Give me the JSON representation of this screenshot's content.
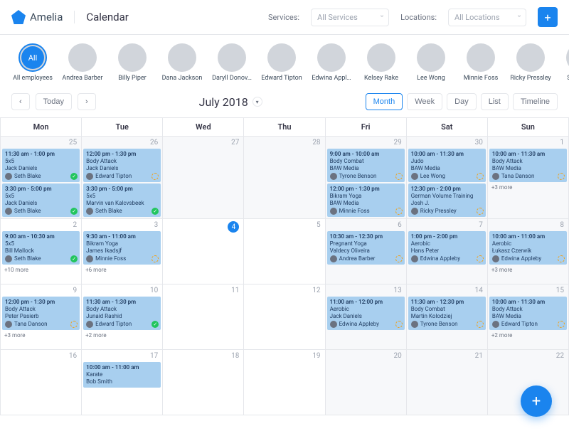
{
  "app": {
    "name": "Amelia",
    "page": "Calendar"
  },
  "filters": {
    "services_label": "Services:",
    "services_value": "All Services",
    "locations_label": "Locations:",
    "locations_value": "All Locations"
  },
  "employees": [
    {
      "name": "All employees",
      "all": true,
      "label": "All"
    },
    {
      "name": "Andrea Barber"
    },
    {
      "name": "Billy Piper"
    },
    {
      "name": "Dana Jackson"
    },
    {
      "name": "Daryll Donov…"
    },
    {
      "name": "Edward Tipton"
    },
    {
      "name": "Edwina Appl…"
    },
    {
      "name": "Kelsey Rake"
    },
    {
      "name": "Lee Wong"
    },
    {
      "name": "Minnie Foss"
    },
    {
      "name": "Ricky Pressley"
    },
    {
      "name": "Seth Blak"
    }
  ],
  "toolbar": {
    "today": "Today",
    "month_label": "July 2018",
    "views": [
      "Month",
      "Week",
      "Day",
      "List",
      "Timeline"
    ],
    "active_view": "Month"
  },
  "dow": [
    "Mon",
    "Tue",
    "Wed",
    "Thu",
    "Fri",
    "Sat",
    "Sun"
  ],
  "weeks": [
    [
      {
        "n": 25,
        "dim": true,
        "events": [
          {
            "time": "11:30 am - 1:00 pm",
            "title": "5x5",
            "sub": "Jack Daniels",
            "person": "Seth Blake",
            "status": "done"
          },
          {
            "time": "3:30 pm - 5:00 pm",
            "title": "5x5",
            "sub": "Jack Daniels",
            "person": "Seth Blake",
            "status": "done"
          }
        ]
      },
      {
        "n": 26,
        "dim": true,
        "events": [
          {
            "time": "12:00 pm - 1:30 pm",
            "title": "Body Attack",
            "sub": "Jack Daniels",
            "person": "Edward Tipton",
            "status": "pending"
          },
          {
            "time": "3:30 pm - 5:00 pm",
            "title": "5x5",
            "sub": "Marvin van Kalcvsbeek",
            "person": "Seth Blake",
            "status": "done"
          }
        ]
      },
      {
        "n": 27,
        "dim": true,
        "events": []
      },
      {
        "n": 28,
        "dim": true,
        "events": []
      },
      {
        "n": 29,
        "dim": true,
        "events": [
          {
            "time": "9:00 am - 10:00 am",
            "title": "Body Combat",
            "sub": "BAW Media",
            "person": "Tyrone Benson",
            "status": "pending"
          },
          {
            "time": "12:00 pm - 1:30 pm",
            "title": "Bikram Yoga",
            "sub": "BAW Media",
            "person": "Minnie Foss",
            "status": "pending"
          }
        ]
      },
      {
        "n": 30,
        "dim": true,
        "events": [
          {
            "time": "10:00 am - 11:30 am",
            "title": "Judo",
            "sub": "BAW Media",
            "person": "Lee Wong",
            "status": "pending"
          },
          {
            "time": "12:30 pm - 2:00 pm",
            "title": "German Volume Training",
            "sub": "Josh J.",
            "person": "Ricky Pressley",
            "status": "pending"
          }
        ]
      },
      {
        "n": 1,
        "dim": true,
        "events": [
          {
            "time": "10:00 am - 11:30 am",
            "title": "Body Attack",
            "sub": "BAW Media",
            "person": "Tana Danson",
            "status": "pending"
          }
        ],
        "more": "+3 more"
      }
    ],
    [
      {
        "n": 2,
        "events": [
          {
            "time": "9:00 am - 10:30 am",
            "title": "5x5",
            "sub": "Bill Mallock",
            "person": "Seth Blake",
            "status": "done"
          }
        ],
        "more": "+10 more"
      },
      {
        "n": 3,
        "events": [
          {
            "time": "9:30 am - 11:00 am",
            "title": "Bikram Yoga",
            "sub": "James Ikadsjf",
            "person": "Minnie Foss",
            "status": "pending"
          }
        ],
        "more": "+6 more"
      },
      {
        "n": 4,
        "today": true,
        "events": []
      },
      {
        "n": 5,
        "events": []
      },
      {
        "n": 6,
        "dim": true,
        "events": [
          {
            "time": "10:30 am - 12:30 pm",
            "title": "Pregnant Yoga",
            "sub": "Valdecy Oliveira",
            "person": "Andrea Barber",
            "status": "pending"
          }
        ]
      },
      {
        "n": 7,
        "dim": true,
        "events": [
          {
            "time": "1:00 pm - 2:00 pm",
            "title": "Aerobic",
            "sub": "Hans Peter",
            "person": "Edwina Appleby",
            "status": "pending"
          }
        ]
      },
      {
        "n": 8,
        "dim": true,
        "events": [
          {
            "time": "10:00 am - 11:00 am",
            "title": "Aerobic",
            "sub": "Łukasz Czerwik",
            "person": "Edwina Appleby",
            "status": "pending"
          }
        ],
        "more": "+3 more"
      }
    ],
    [
      {
        "n": 9,
        "events": [
          {
            "time": "12:00 pm - 1:30 pm",
            "title": "Body Attack",
            "sub": "Peter Pasierb",
            "person": "Tana Danson",
            "status": "pending"
          }
        ],
        "more": "+3 more"
      },
      {
        "n": 10,
        "events": [
          {
            "time": "11:30 am - 1:30 pm",
            "title": "Body Attack",
            "sub": "Junaid Rashid",
            "person": "Edward Tipton",
            "status": "done"
          }
        ],
        "more": "+2 more"
      },
      {
        "n": 11,
        "events": []
      },
      {
        "n": 12,
        "events": []
      },
      {
        "n": 13,
        "dim": true,
        "events": [
          {
            "time": "11:00 am - 12:00 pm",
            "title": "Aerobic",
            "sub": "Jack Daniels",
            "person": "Edwina Appleby",
            "status": "pending"
          }
        ]
      },
      {
        "n": 14,
        "dim": true,
        "events": [
          {
            "time": "11:30 am - 12:30 pm",
            "title": "Body Combat",
            "sub": "Martin Kolodziej",
            "person": "Tyrone Benson",
            "status": "pending"
          }
        ]
      },
      {
        "n": 15,
        "dim": true,
        "events": [
          {
            "time": "10:00 am - 11:30 am",
            "title": "Body Attack",
            "sub": "BAW Media",
            "person": "Edward Tipton",
            "status": "pending"
          }
        ],
        "more": "+2 more"
      }
    ],
    [
      {
        "n": 16,
        "events": []
      },
      {
        "n": 17,
        "events": [
          {
            "time": "10:00 am - 11:00 am",
            "title": "Karate",
            "sub": "Bob Smith",
            "person": "",
            "status": ""
          }
        ]
      },
      {
        "n": 18,
        "events": []
      },
      {
        "n": 19,
        "events": []
      },
      {
        "n": 20,
        "dim": true,
        "events": []
      },
      {
        "n": 21,
        "dim": true,
        "events": []
      },
      {
        "n": 22,
        "dim": true,
        "events": []
      }
    ]
  ]
}
